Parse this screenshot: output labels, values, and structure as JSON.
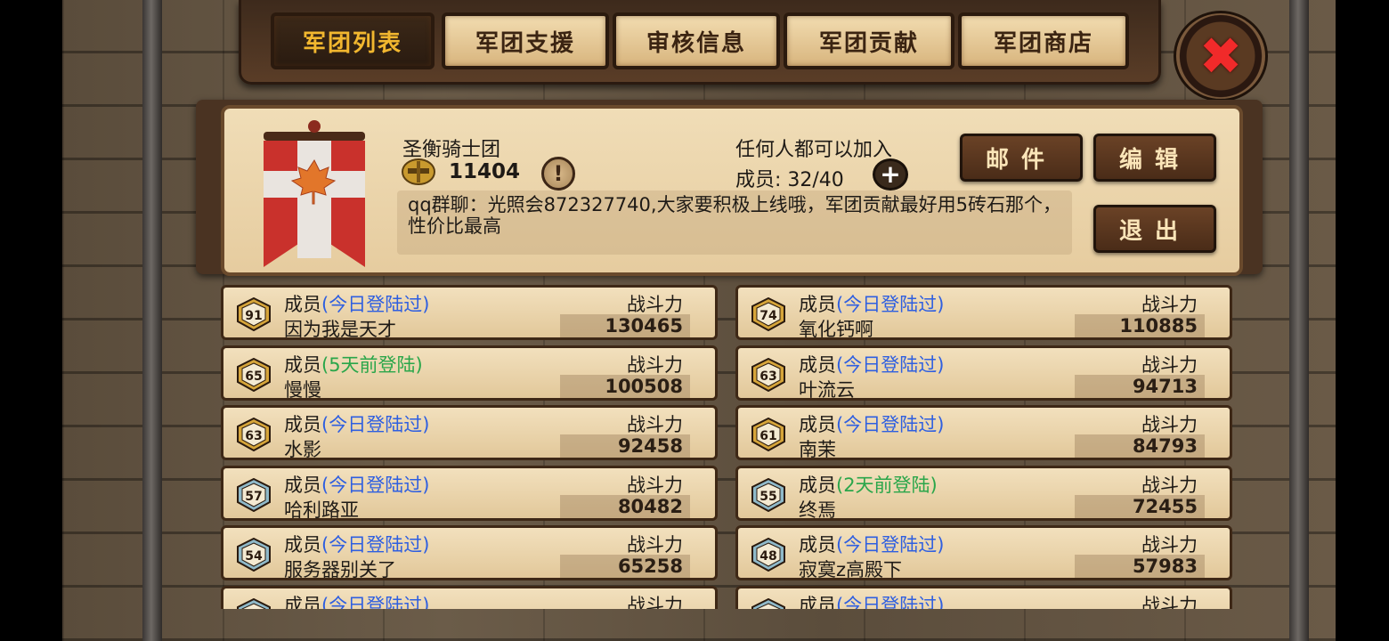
{
  "tabs": [
    {
      "label": "军团列表",
      "active": true
    },
    {
      "label": "军团支援",
      "active": false
    },
    {
      "label": "审核信息",
      "active": false
    },
    {
      "label": "军团贡献",
      "active": false
    },
    {
      "label": "军团商店",
      "active": false
    }
  ],
  "close_icon": "close-x-icon",
  "guild": {
    "name": "圣衡骑士团",
    "score": "11404",
    "join_policy": "任何人都可以加入",
    "members_text": "成员: 32/40",
    "announcement": "qq群聊：光照会872327740,大家要积极上线哦，军团贡献最好用5砖石那个，性价比最高",
    "banner_icon": "maple-leaf-banner-icon"
  },
  "buttons": {
    "mail": "邮件",
    "edit": "编辑",
    "quit": "退出"
  },
  "colors": {
    "status_online": "#2f5fe0",
    "status_offline": "#2aa64a",
    "tab_active_text": "#f2b72f"
  },
  "member_list": {
    "power_label": "战斗力",
    "members": [
      {
        "role": "成员",
        "status": "(今日登陆过)",
        "status_type": "online",
        "name": "因为我是天才",
        "level": "91",
        "power": "130465"
      },
      {
        "role": "成员",
        "status": "(今日登陆过)",
        "status_type": "online",
        "name": "氧化钙啊",
        "level": "74",
        "power": "110885"
      },
      {
        "role": "成员",
        "status": "(5天前登陆)",
        "status_type": "offline",
        "name": "慢慢",
        "level": "65",
        "power": "100508"
      },
      {
        "role": "成员",
        "status": "(今日登陆过)",
        "status_type": "online",
        "name": "叶流云",
        "level": "63",
        "power": "94713"
      },
      {
        "role": "成员",
        "status": "(今日登陆过)",
        "status_type": "online",
        "name": "水影",
        "level": "63",
        "power": "92458"
      },
      {
        "role": "成员",
        "status": "(今日登陆过)",
        "status_type": "online",
        "name": "南茉",
        "level": "61",
        "power": "84793"
      },
      {
        "role": "成员",
        "status": "(今日登陆过)",
        "status_type": "online",
        "name": "哈利路亚",
        "level": "57",
        "power": "80482"
      },
      {
        "role": "成员",
        "status": "(2天前登陆)",
        "status_type": "offline",
        "name": "终焉",
        "level": "55",
        "power": "72455"
      },
      {
        "role": "成员",
        "status": "(今日登陆过)",
        "status_type": "online",
        "name": "服务器别关了",
        "level": "54",
        "power": "65258"
      },
      {
        "role": "成员",
        "status": "(今日登陆过)",
        "status_type": "online",
        "name": "寂寞z高殿下",
        "level": "48",
        "power": "57983"
      },
      {
        "role": "成员",
        "status": "(今日登陆过)",
        "status_type": "online",
        "name": "",
        "level": "",
        "power": ""
      },
      {
        "role": "成员",
        "status": "(今日登陆过)",
        "status_type": "online",
        "name": "",
        "level": "",
        "power": ""
      }
    ]
  }
}
